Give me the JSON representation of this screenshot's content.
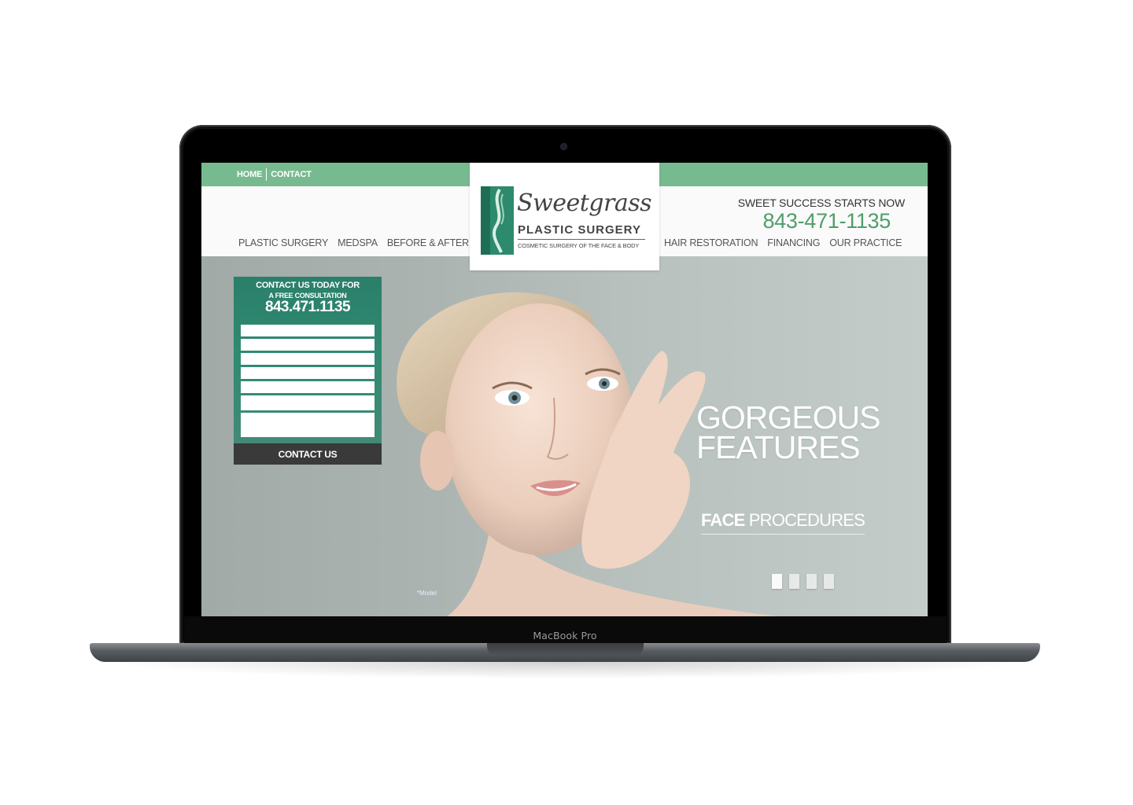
{
  "device": {
    "label": "MacBook Pro"
  },
  "site": {
    "top_nav": {
      "home": "HOME",
      "contact": "CONTACT"
    },
    "main_nav_left": [
      "PLASTIC SURGERY",
      "MEDSPA",
      "BEFORE & AFTER"
    ],
    "main_nav_right": [
      "HAIR RESTORATION",
      "FINANCING",
      "OUR PRACTICE"
    ],
    "header": {
      "tagline": "SWEET SUCCESS STARTS NOW",
      "phone": "843-471-1135"
    },
    "logo": {
      "script": "Sweetgrass",
      "name": "PLASTIC SURGERY",
      "subtitle": "COSMETIC SURGERY OF THE FACE & BODY"
    },
    "contact_panel": {
      "line1": "CONTACT US TODAY FOR",
      "line2": "A FREE CONSULTATION",
      "phone": "843.471.1135",
      "button": "CONTACT US"
    },
    "hero": {
      "title_line1": "GORGEOUS",
      "title_line2": "FEATURES",
      "sub_bold": "FACE",
      "sub_rest": " PROCEDURES",
      "model_note": "*Model",
      "slide_count": 4,
      "active_slide": 1
    },
    "colors": {
      "accent_green": "#77ba8f",
      "panel_green": "#2b7f6a",
      "phone_green": "#4f9d6b"
    }
  }
}
